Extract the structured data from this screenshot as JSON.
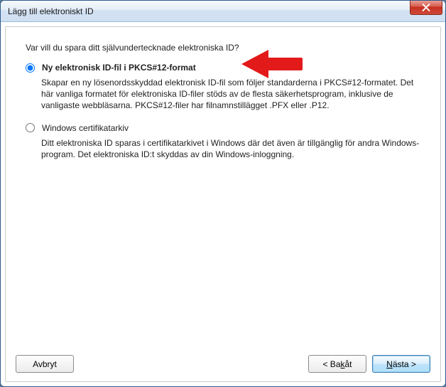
{
  "window": {
    "title": "Lägg till elektroniskt ID"
  },
  "question": "Var vill du spara ditt självundertecknade elektroniska ID?",
  "options": {
    "pkcs12": {
      "label": "Ny elektronisk ID-fil i PKCS#12-format",
      "description": "Skapar en ny lösenordsskyddad elektronisk ID-fil som följer standarderna i PKCS#12-formatet. Det här vanliga formatet för elektroniska ID-filer stöds av de flesta säkerhetsprogram, inklusive de vanligaste webbläsarna. PKCS#12-filer har filnamnstillägget .PFX eller .P12.",
      "selected": true
    },
    "wincert": {
      "label": "Windows certifikatarkiv",
      "description": "Ditt elektroniska ID sparas i certifikatarkivet i Windows där det även är tillgänglig för andra Windows-program. Det elektroniska ID:t skyddas av din Windows-inloggning.",
      "selected": false
    }
  },
  "buttons": {
    "cancel": "Avbryt",
    "back_prefix": "< Ba",
    "back_u": "k",
    "back_suffix": "åt",
    "next_u": "N",
    "next_suffix": "ästa >"
  }
}
